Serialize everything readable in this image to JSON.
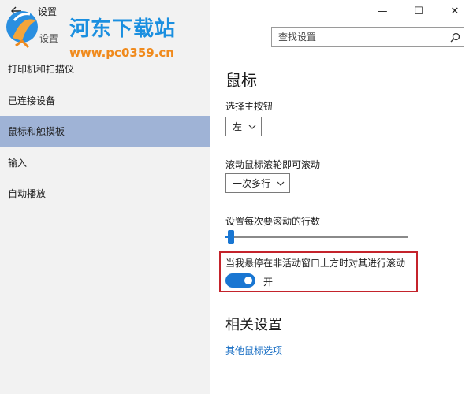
{
  "window": {
    "title": "设置",
    "controls": {
      "minimize": "—",
      "maximize": "☐",
      "close": "✕"
    }
  },
  "left_header": {
    "label": "设置"
  },
  "search": {
    "placeholder": "查找设置"
  },
  "nav": {
    "items": [
      {
        "label": "打印机和扫描仪",
        "selected": false
      },
      {
        "label": "已连接设备",
        "selected": false
      },
      {
        "label": "鼠标和触摸板",
        "selected": true
      },
      {
        "label": "输入",
        "selected": false
      },
      {
        "label": "自动播放",
        "selected": false
      }
    ]
  },
  "watermark": {
    "title": "河东下载站",
    "url": "www.pc0359.cn"
  },
  "main": {
    "title": "鼠标",
    "primary_button": {
      "label": "选择主按钮",
      "value": "左"
    },
    "wheel_scroll": {
      "label": "滚动鼠标滚轮即可滚动",
      "value": "一次多行"
    },
    "lines_to_scroll": {
      "label": "设置每次要滚动的行数",
      "level": 0.03
    },
    "inactive_scroll": {
      "label": "当我悬停在非活动窗口上方时对其进行滚动",
      "state": "开"
    },
    "related": {
      "title": "相关设置",
      "link": "其他鼠标选项"
    }
  },
  "colors": {
    "accent": "#1976d2",
    "selection": "#9fb3d6",
    "highlight_border": "#c4232b",
    "link": "#1a6fc4"
  }
}
